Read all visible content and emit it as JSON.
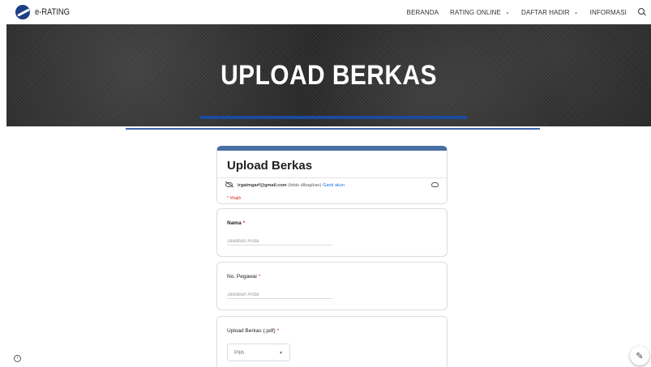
{
  "brand": {
    "name": "e-RATING"
  },
  "nav": {
    "items": [
      {
        "label": "BERANDA",
        "dropdown": false
      },
      {
        "label": "RATING ONLINE",
        "dropdown": true
      },
      {
        "label": "DAFTAR HADIR",
        "dropdown": true
      },
      {
        "label": "INFORMASI",
        "dropdown": false
      }
    ],
    "search_icon": "search-icon"
  },
  "hero": {
    "title": "UPLOAD BERKAS"
  },
  "form": {
    "title": "Upload Berkas",
    "account_email": "irgatmgarf@gmail.com",
    "account_note": "(tidak dibagikan)",
    "switch_account": "Ganti akun",
    "required_note": "* Wajib",
    "questions": [
      {
        "label": "Nama",
        "placeholder": "Jawaban Anda"
      },
      {
        "label": "No. Pegawai",
        "placeholder": "Jawaban Anda"
      }
    ],
    "upload": {
      "label": "Upload Berkas (.pdf)",
      "select_value": "Pilih",
      "caret": "▼"
    },
    "required_marker": "*"
  },
  "icons": {
    "info": "i",
    "edit": "✎",
    "chevron": "⌄"
  },
  "colors": {
    "accent": "#1c4b9c",
    "form_accent": "#4a6fa5",
    "required": "#d93025",
    "link": "#1a73e8"
  }
}
